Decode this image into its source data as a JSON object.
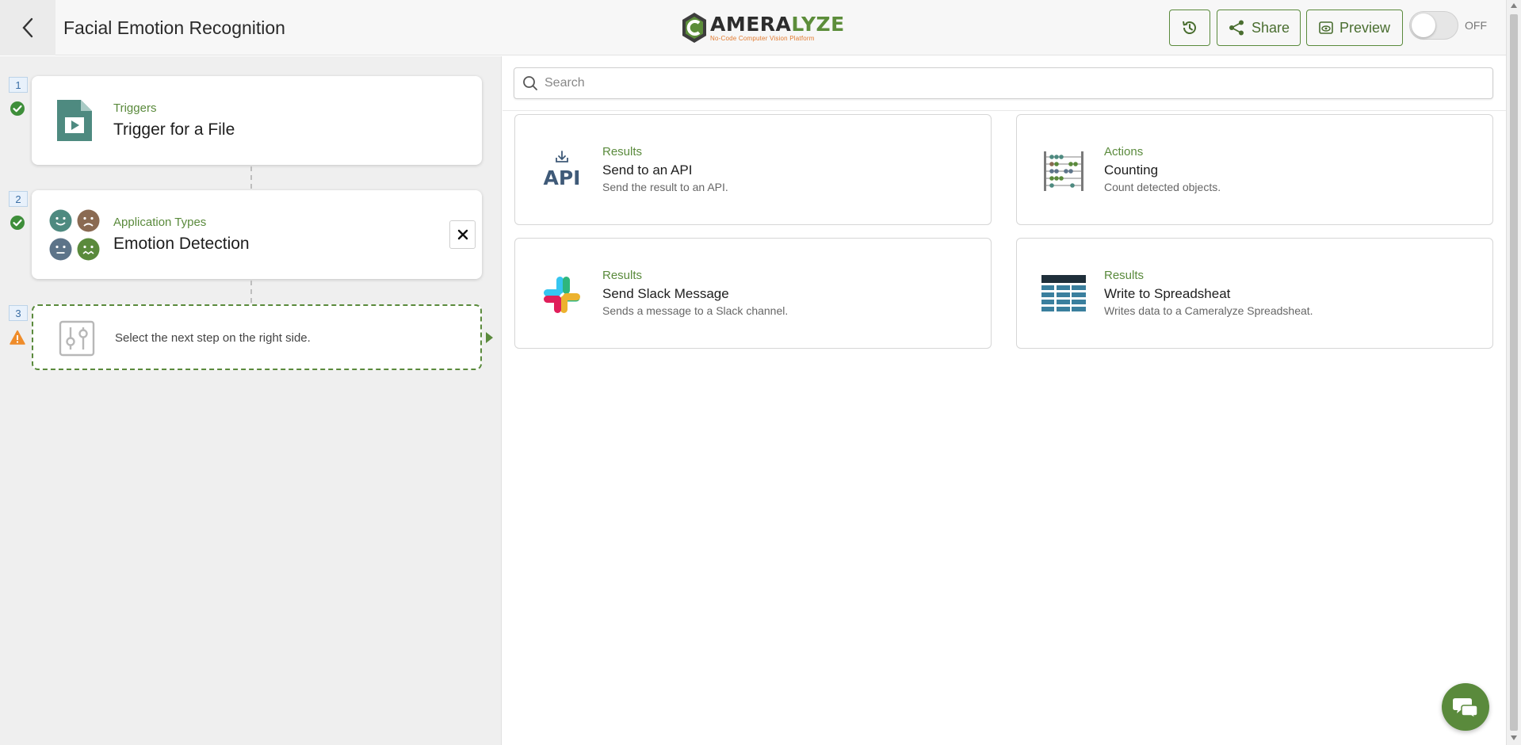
{
  "header": {
    "title": "Facial Emotion Recognition",
    "back_icon": "chevron-left-icon",
    "logo": {
      "prefix": "C",
      "word_dark": "AMERA",
      "word_accent": "LYZE",
      "tagline": "No-Code Computer Vision Platform"
    },
    "history_icon": "history-icon",
    "share_label": "Share",
    "preview_label": "Preview",
    "toggle_label": "OFF",
    "toggle_on": false,
    "accent_color": "#5a8a3c"
  },
  "steps": [
    {
      "number": "1",
      "status": "complete",
      "category": "Triggers",
      "title": "Trigger for a File",
      "icon": "video-file-icon"
    },
    {
      "number": "2",
      "status": "complete",
      "category": "Application Types",
      "title": "Emotion Detection",
      "icon": "emotion-faces-icon"
    },
    {
      "number": "3",
      "status": "warning",
      "prompt": "Select the next step on the right side.",
      "icon": "sliders-icon"
    }
  ],
  "search": {
    "placeholder": "Search",
    "value": ""
  },
  "options": [
    {
      "category": "Results",
      "title": "Send to an API",
      "description": "Send the result to an API.",
      "icon": "api-icon",
      "icon_text": "API"
    },
    {
      "category": "Actions",
      "title": "Counting",
      "description": "Count detected objects.",
      "icon": "abacus-icon"
    },
    {
      "category": "Results",
      "title": "Send Slack Message",
      "description": "Sends a message to a Slack channel.",
      "icon": "slack-icon"
    },
    {
      "category": "Results",
      "title": "Write to Spreadsheat",
      "description": "Writes data to a Cameralyze Spreadsheat.",
      "icon": "spreadsheet-icon"
    }
  ],
  "chat_icon": "chat-bubbles-icon"
}
